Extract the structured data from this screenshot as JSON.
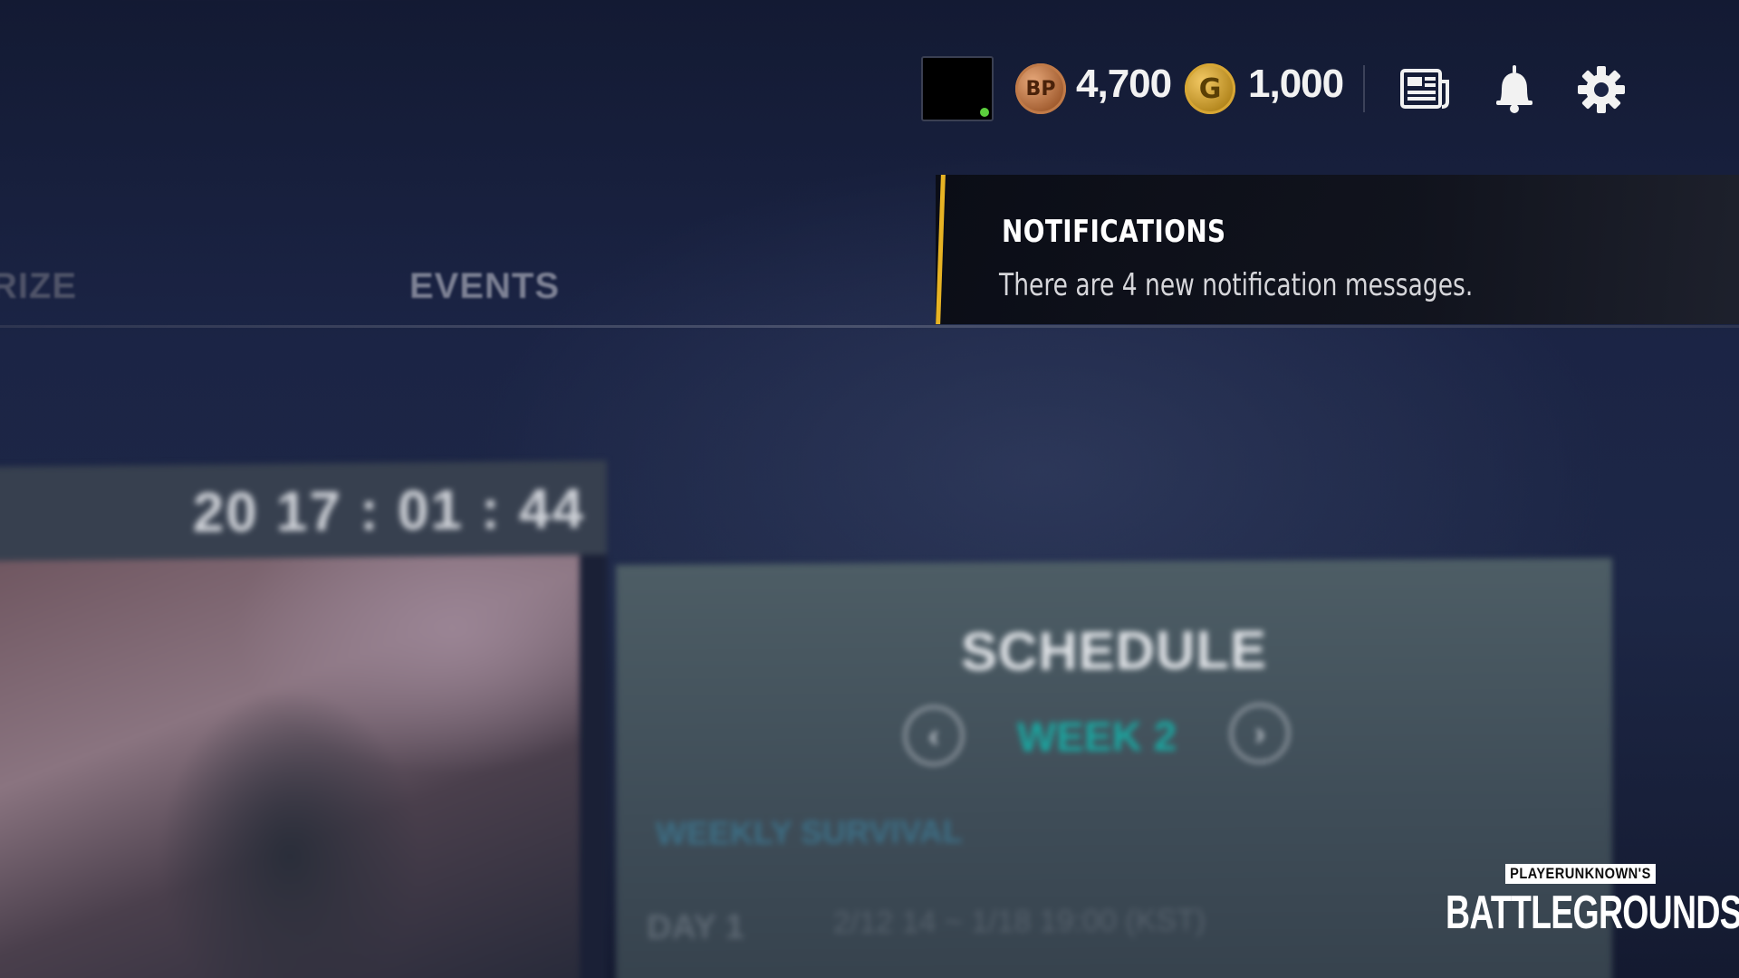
{
  "currencies": {
    "bp": {
      "icon": "bp-coin-icon",
      "label": "BP",
      "amount": "4,700",
      "color": "#b06a3a"
    },
    "g_coin": {
      "icon": "g-coin-icon",
      "label": "G",
      "amount": "1,000",
      "color": "#c89a2a"
    }
  },
  "toolbar": {
    "news": "news-icon",
    "notifications": "bell-icon",
    "settings": "gear-icon"
  },
  "tabs": [
    {
      "label": "RIZE"
    },
    {
      "label": "EVENTS"
    }
  ],
  "notification": {
    "title": "NOTIFICATIONS",
    "message": "There are 4 new notification messages.",
    "accent_color": "#e7b324"
  },
  "event": {
    "timer": "20 17 : 01 : 44"
  },
  "schedule": {
    "title": "SCHEDULE",
    "week": "WEEK 2",
    "prev_glyph": "‹",
    "next_glyph": "›",
    "section": "WEEKLY SURVIVAL",
    "day": "DAY 1",
    "day_time": "2/12 14 ~ 1/18 19:00 (KST)",
    "week_color": "#1aa6a0"
  },
  "logo": {
    "top": "PLAYERUNKNOWN'S",
    "main": "BATTLEGROUNDS"
  }
}
